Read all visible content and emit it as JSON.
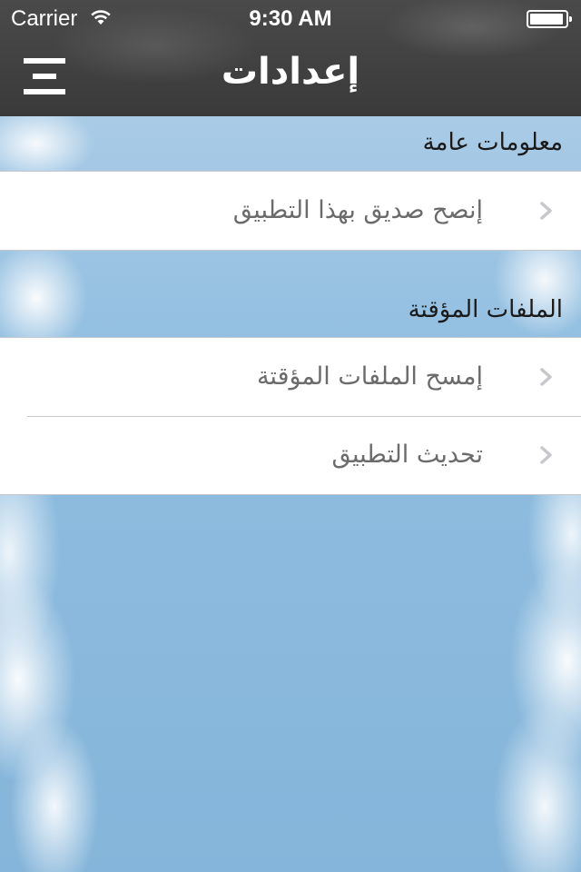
{
  "status_bar": {
    "carrier": "Carrier",
    "time": "9:30 AM",
    "wifi_icon": "wifi-icon",
    "battery_icon": "battery-full-icon"
  },
  "nav": {
    "title": "إعدادات",
    "menu_icon": "hamburger-menu-icon"
  },
  "sections": [
    {
      "header": "معلومات عامة",
      "items": [
        {
          "label": "إنصح صديق بهذا التطبيق",
          "icon": "chevron-right-icon"
        }
      ]
    },
    {
      "header": "الملفات المؤقتة",
      "items": [
        {
          "label": "إمسح الملفات المؤقتة",
          "icon": "chevron-right-icon"
        },
        {
          "label": "تحديث التطبيق",
          "icon": "chevron-right-icon"
        }
      ]
    }
  ],
  "colors": {
    "nav_bg": "#3f3f3f",
    "sky": "#87b6d9",
    "row_text": "#6b6b6b",
    "chevron": "#c7c7cc"
  }
}
